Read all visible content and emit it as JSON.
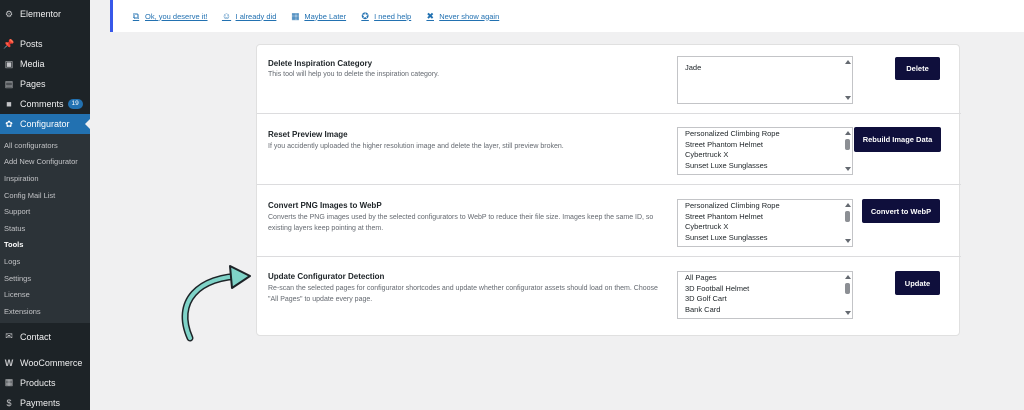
{
  "sidebar": {
    "items_top": [
      {
        "label": "Elementor",
        "icon": "elementor-icon"
      },
      {
        "label": "Posts",
        "icon": "pin-icon"
      },
      {
        "label": "Media",
        "icon": "media-icon"
      },
      {
        "label": "Pages",
        "icon": "pages-icon"
      },
      {
        "label": "Comments",
        "icon": "comments-icon",
        "badge": "19"
      }
    ],
    "active": {
      "label": "Configurator",
      "icon": "configurator-icon"
    },
    "submenu": [
      "All configurators",
      "Add New Configurator",
      "Inspiration",
      "Config Mail List",
      "Support",
      "Status",
      "Tools",
      "Logs",
      "Settings",
      "License",
      "Extensions"
    ],
    "submenu_current": "Tools",
    "items_bottom": [
      {
        "label": "Contact",
        "icon": "mail-icon"
      },
      {
        "label": "WooCommerce",
        "icon": "woocommerce-icon"
      },
      {
        "label": "Products",
        "icon": "products-icon"
      },
      {
        "label": "Payments",
        "icon": "payments-icon"
      }
    ]
  },
  "notice": {
    "links": [
      {
        "label": "Ok, you deserve it!",
        "icon": "external-link-icon"
      },
      {
        "label": "I already did",
        "icon": "smile-icon"
      },
      {
        "label": "Maybe Later",
        "icon": "calendar-icon"
      },
      {
        "label": "I need help",
        "icon": "help-icon"
      },
      {
        "label": "Never show again",
        "icon": "dismiss-icon"
      }
    ]
  },
  "tools": [
    {
      "title": "Delete Inspiration Category",
      "description": "This tool will help you to delete the inspiration category.",
      "options": [
        "Jade"
      ],
      "button": "Delete"
    },
    {
      "title": "Reset Preview Image",
      "description": "If you accidently uploaded the higher resolution image and delete the layer, still preview broken.",
      "options": [
        "Personalized Climbing Rope",
        "Street Phantom Helmet",
        "Cybertruck X",
        "Sunset Luxe Sunglasses"
      ],
      "button": "Rebuild Image Data"
    },
    {
      "title": "Convert PNG Images to WebP",
      "description": "Converts the PNG images used by the selected configurators to WebP to reduce their file size. Images keep the same ID, so existing layers keep pointing at them.",
      "options": [
        "Personalized Climbing Rope",
        "Street Phantom Helmet",
        "Cybertruck X",
        "Sunset Luxe Sunglasses"
      ],
      "button": "Convert to WebP"
    },
    {
      "title": "Update Configurator Detection",
      "description": "Re-scan the selected pages for configurator shortcodes and update whether configurator assets should load on them. Choose \"All Pages\" to update every page.",
      "options": [
        "All Pages",
        "3D Football Helmet",
        "3D Golf Cart",
        "Bank Card"
      ],
      "button": "Update"
    }
  ]
}
